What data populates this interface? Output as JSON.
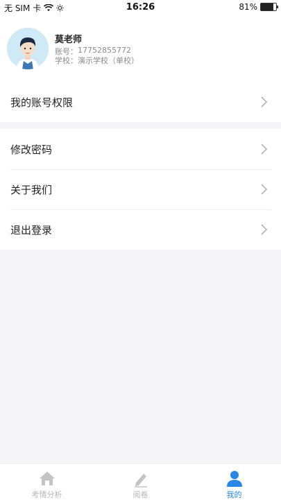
{
  "status_bar": {
    "carrier": "无 SIM 卡",
    "time": "16:26",
    "battery": "81%",
    "battery_level": 0.81
  },
  "profile": {
    "name": "莫老师",
    "account_label": "账号：",
    "account_value": "17752855772",
    "school_label": "学校：",
    "school_value": "演示学校（单校）"
  },
  "menu": {
    "permissions": "我的账号权限",
    "change_password": "修改密码",
    "about_us": "关于我们",
    "logout": "退出登录"
  },
  "tabbar": {
    "items": [
      {
        "label": "考情分析",
        "icon": "home-icon",
        "active": false
      },
      {
        "label": "阅卷",
        "icon": "pencil-icon",
        "active": false
      },
      {
        "label": "我的",
        "icon": "user-icon",
        "active": true
      }
    ]
  },
  "colors": {
    "accent": "#2a86e6",
    "inactive": "#b5b5b5",
    "background": "#f5f5f7"
  }
}
